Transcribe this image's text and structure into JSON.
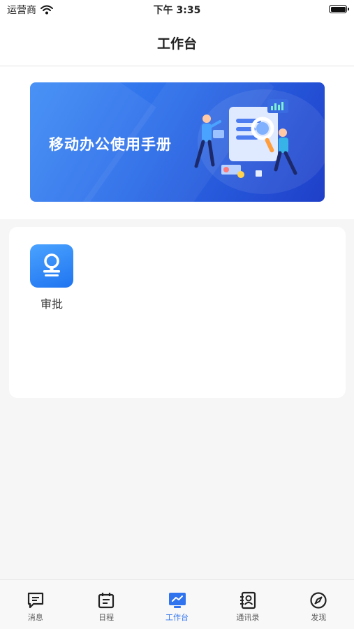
{
  "status_bar": {
    "carrier": "运营商",
    "time": "下午 3:35"
  },
  "header": {
    "title": "工作台"
  },
  "banner": {
    "title": "移动办公使用手册"
  },
  "apps": [
    {
      "label": "审批",
      "icon": "approval-stamp-icon"
    }
  ],
  "tabbar": {
    "items": [
      {
        "label": "消息",
        "icon": "message-icon",
        "active": false
      },
      {
        "label": "日程",
        "icon": "calendar-icon",
        "active": false
      },
      {
        "label": "工作台",
        "icon": "workbench-icon",
        "active": true
      },
      {
        "label": "通讯录",
        "icon": "contacts-icon",
        "active": false
      },
      {
        "label": "发现",
        "icon": "compass-icon",
        "active": false
      }
    ]
  },
  "colors": {
    "accent": "#2f73ef",
    "background": "#f6f6f7",
    "banner": "#2c6ce8"
  }
}
